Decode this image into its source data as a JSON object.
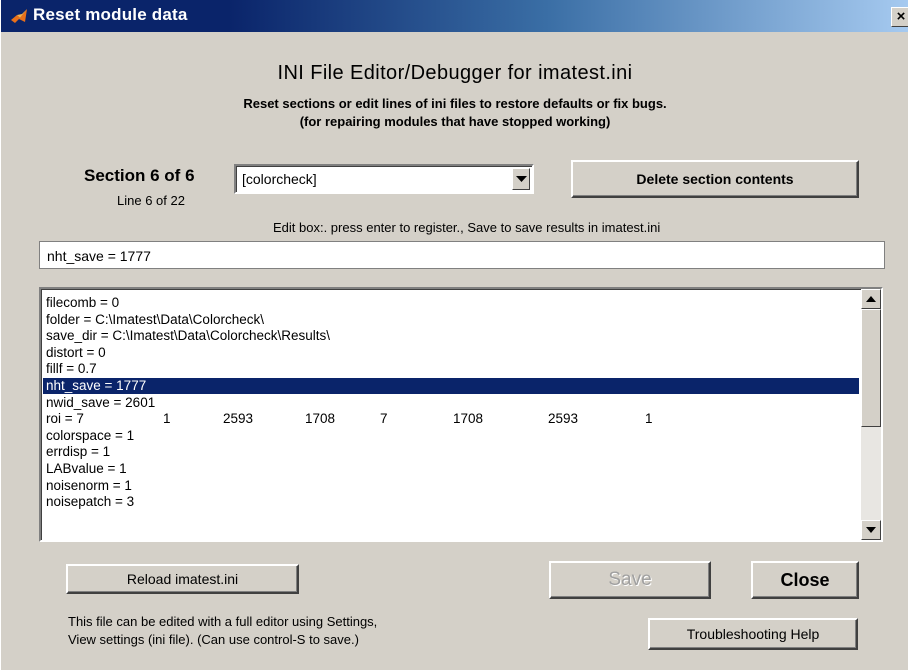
{
  "window": {
    "title": "Reset module data",
    "close_glyph": "×"
  },
  "header": {
    "heading": "INI File Editor/Debugger for imatest.ini",
    "subtitle_line1": "Reset sections or edit lines of ini files to restore defaults or fix bugs.",
    "subtitle_line2": "(for repairing modules that have stopped working)"
  },
  "section": {
    "label": "Section 6 of 6",
    "line_label": "Line 6 of 22",
    "dropdown_value": "[colorcheck]",
    "delete_button": "Delete section contents"
  },
  "editor": {
    "caption": "Edit box:. press enter  to register., Save to save results in imatest.ini",
    "value": "nht_save = 1777"
  },
  "list": {
    "selected_index": 5,
    "items": [
      "filecomb = 0",
      "folder = C:\\Imatest\\Data\\Colorcheck\\",
      "save_dir = C:\\Imatest\\Data\\Colorcheck\\Results\\",
      "distort = 0",
      "fillf = 0.7",
      "nht_save = 1777",
      "nwid_save = 2601",
      "roi = 7",
      "colorspace = 1",
      "errdisp = 1",
      "LABvalue = 1",
      "noisenorm = 1",
      "noisepatch = 3"
    ],
    "roi_values": [
      "1",
      "2593",
      "1708",
      "7",
      "1708",
      "2593",
      "1"
    ]
  },
  "buttons": {
    "reload": "Reload imatest.ini",
    "save": "Save",
    "close": "Close",
    "help": "Troubleshooting Help"
  },
  "footer": {
    "note_line1": "This file can be edited with a full editor using Settings,",
    "note_line2": "View settings (ini file).  (Can use control-S to save.)"
  },
  "colors": {
    "window_bg": "#d4d0c8",
    "title_start": "#0a246a",
    "title_end": "#a6caf0",
    "selection": "#0a246a",
    "disabled_text": "#a0a0a0"
  },
  "icons": {
    "title_icon": "matlab-icon",
    "dropdown_arrow": "chevron-down-icon",
    "scroll_up": "arrow-up-icon",
    "scroll_down": "arrow-down-icon"
  }
}
